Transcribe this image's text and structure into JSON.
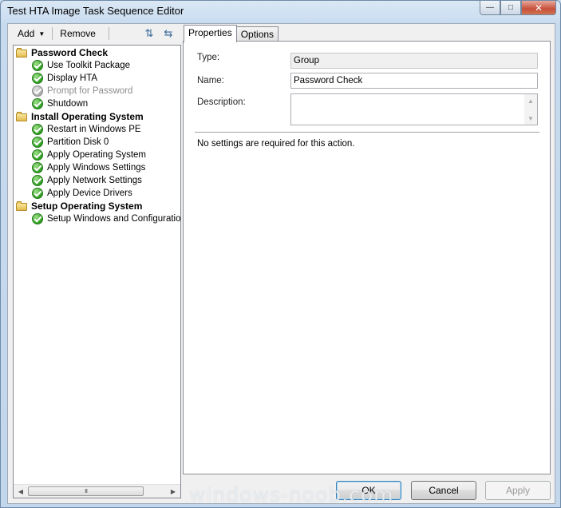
{
  "window": {
    "title": "Test HTA Image Task Sequence Editor",
    "minimize": "—",
    "maximize": "□",
    "close": "✕"
  },
  "toolbar": {
    "add_label": "Add",
    "remove_label": "Remove",
    "icons": [
      "move-up-icon",
      "move-down-icon"
    ]
  },
  "tree": {
    "items": [
      {
        "label": "Password Check",
        "type": "group"
      },
      {
        "label": "Use Toolkit Package",
        "type": "step"
      },
      {
        "label": "Display HTA",
        "type": "step"
      },
      {
        "label": "Prompt for Password",
        "type": "step",
        "disabled": true
      },
      {
        "label": "Shutdown",
        "type": "step"
      },
      {
        "label": "Install Operating System",
        "type": "group"
      },
      {
        "label": "Restart in Windows PE",
        "type": "step"
      },
      {
        "label": "Partition Disk 0",
        "type": "step"
      },
      {
        "label": "Apply Operating System",
        "type": "step"
      },
      {
        "label": "Apply Windows Settings",
        "type": "step"
      },
      {
        "label": "Apply Network Settings",
        "type": "step"
      },
      {
        "label": "Apply Device Drivers",
        "type": "step"
      },
      {
        "label": "Setup Operating System",
        "type": "group"
      },
      {
        "label": "Setup Windows and Configuration",
        "type": "step"
      }
    ],
    "scroll_thumb_grip": "III"
  },
  "tabs": {
    "properties": "Properties",
    "options": "Options"
  },
  "properties": {
    "type_label": "Type:",
    "type_value": "Group",
    "name_label": "Name:",
    "name_value": "Password Check",
    "description_label": "Description:",
    "description_value": "",
    "note": "No settings are required  for this action."
  },
  "buttons": {
    "ok": "OK",
    "cancel": "Cancel",
    "apply": "Apply"
  },
  "watermark": "windows-noob.com"
}
